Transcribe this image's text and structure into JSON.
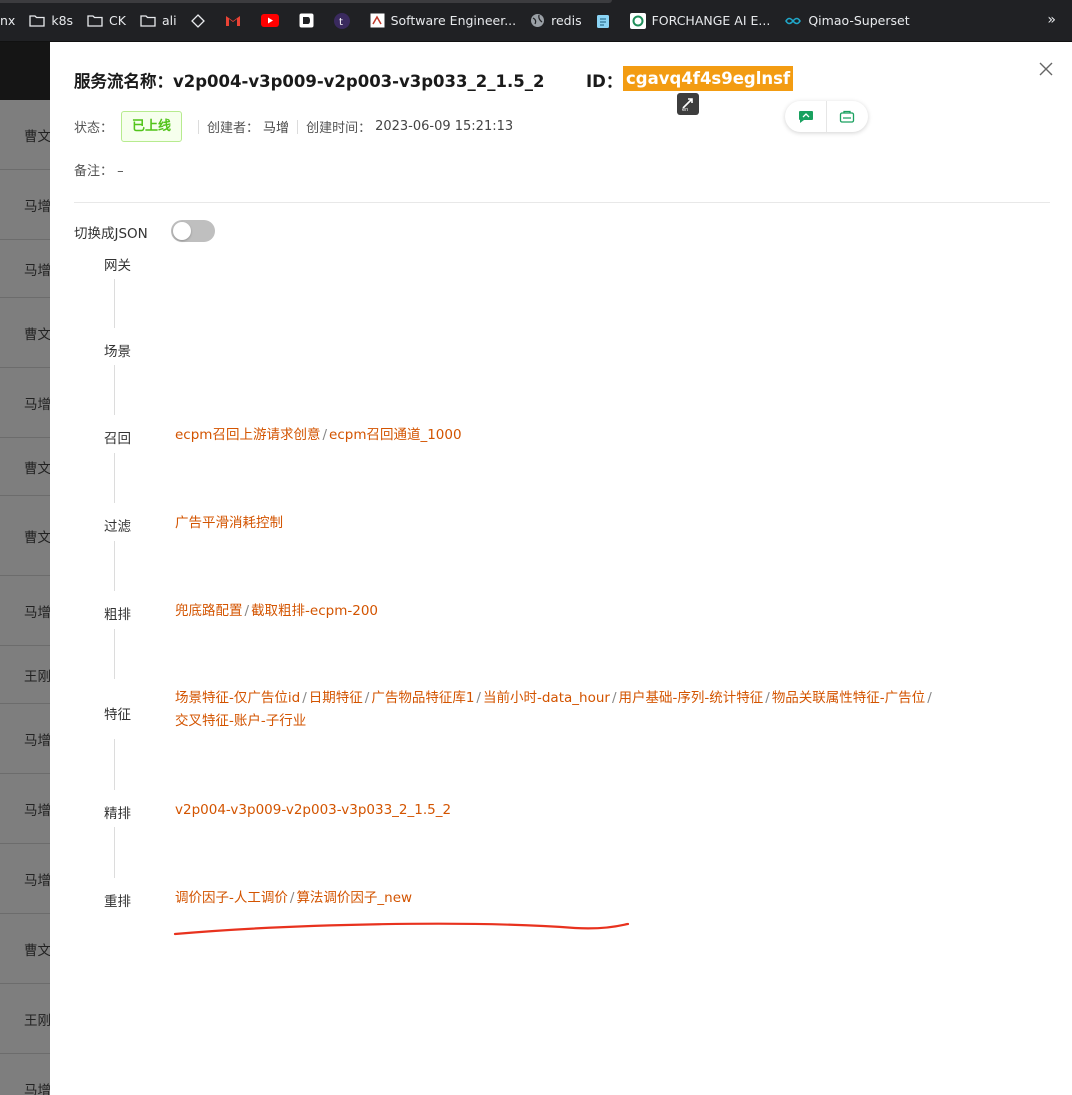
{
  "bookmarks": [
    {
      "label": "nx",
      "icon": "none"
    },
    {
      "label": "k8s",
      "icon": "folder-icon"
    },
    {
      "label": "CK",
      "icon": "folder-icon"
    },
    {
      "label": "ali",
      "icon": "folder-icon"
    },
    {
      "label": "",
      "icon": "diamond-icon"
    },
    {
      "label": "",
      "icon": "gmail-icon"
    },
    {
      "label": "",
      "icon": "youtube-icon"
    },
    {
      "label": "",
      "icon": "dashlane-icon"
    },
    {
      "label": "",
      "icon": "tumblr-icon"
    },
    {
      "label": "Software Engineer...",
      "icon": "site-icon"
    },
    {
      "label": "redis",
      "icon": "globe-icon"
    },
    {
      "label": "",
      "icon": "note-icon"
    },
    {
      "label": "FORCHANGE AI E...",
      "icon": "forchange-icon"
    },
    {
      "label": "Qimao-Superset",
      "icon": "superset-icon"
    }
  ],
  "bookmarks_more": "»",
  "background_rows": [
    "曹文",
    "马增",
    "马增",
    "曹文",
    "马增",
    "曹文",
    "曹文",
    "马增",
    "王刚",
    "马增",
    "马增",
    "马增",
    "曹文",
    "王刚",
    "马增"
  ],
  "drawer": {
    "title_label": "服务流名称：",
    "title_value": "v2p004-v3p009-v2p003-v3p033_2_1.5_2",
    "id_label": "ID：",
    "id_value": "cgavq4f4s9eglnsf",
    "status_label": "状态：",
    "status_value": "已上线",
    "creator_label": "创建者：",
    "creator_value": "马增",
    "created_time_label": "创建时间：",
    "created_time_value": "2023-06-09 15:21:13",
    "remark_label": "备注：",
    "remark_value": "–",
    "json_toggle_label": "切换成JSON",
    "json_toggle_on": false
  },
  "flow_steps": [
    {
      "label": "网关",
      "values": []
    },
    {
      "label": "场景",
      "values": []
    },
    {
      "label": "召回",
      "values": [
        "ecpm召回上游请求创意",
        "ecpm召回通道_1000"
      ]
    },
    {
      "label": "过滤",
      "values": [
        "广告平滑消耗控制"
      ]
    },
    {
      "label": "粗排",
      "values": [
        "兜底路配置",
        "截取粗排-ecpm-200"
      ]
    },
    {
      "label": "特征",
      "values": [
        "场景特征-仅广告位id",
        "日期特征",
        "广告物品特征库1",
        "当前小时-data_hour",
        "用户基础-序列-统计特征",
        "物品关联属性特征-广告位",
        "交叉特征-账户-子行业"
      ]
    },
    {
      "label": "精排",
      "values": [
        "v2p004-v3p009-v2p003-v3p033_2_1.5_2"
      ]
    },
    {
      "label": "重排",
      "values": [
        "调价因子-人工调价",
        "算法调价因子_new"
      ]
    }
  ],
  "colors": {
    "accent_orange": "#d35400",
    "id_highlight": "#f39c12",
    "status_green": "#52c41a",
    "annotation_red": "#e8321e"
  }
}
